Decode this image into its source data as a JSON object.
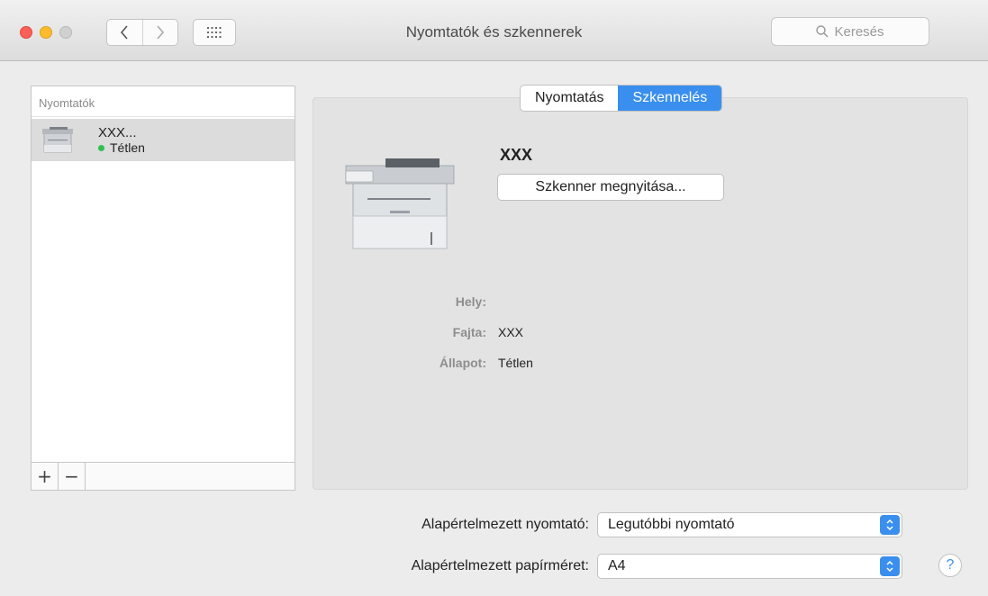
{
  "window": {
    "title": "Nyomtatók és szkennerek",
    "search_placeholder": "Keresés"
  },
  "printer_list": {
    "header": "Nyomtatók",
    "items": [
      {
        "name": "XXX...",
        "status": "Tétlen",
        "status_color": "#30c04f"
      }
    ],
    "add_label": "+",
    "remove_label": "−"
  },
  "tabs": [
    {
      "label": "Nyomtatás",
      "active": false
    },
    {
      "label": "Szkennelés",
      "active": true
    }
  ],
  "device": {
    "name": "XXX",
    "open_scanner_label": "Szkenner megnyitása...",
    "fields": [
      {
        "label": "Hely:",
        "value": ""
      },
      {
        "label": "Fajta:",
        "value": "XXX"
      },
      {
        "label": "Állapot:",
        "value": "Tétlen"
      }
    ]
  },
  "defaults": {
    "printer_label": "Alapértelmezett nyomtató:",
    "printer_value": "Legutóbbi nyomtató",
    "paper_label": "Alapértelmezett papírméret:",
    "paper_value": "A4"
  },
  "help_label": "?",
  "colors": {
    "accent": "#3a8fee",
    "status_green": "#30c04f"
  }
}
